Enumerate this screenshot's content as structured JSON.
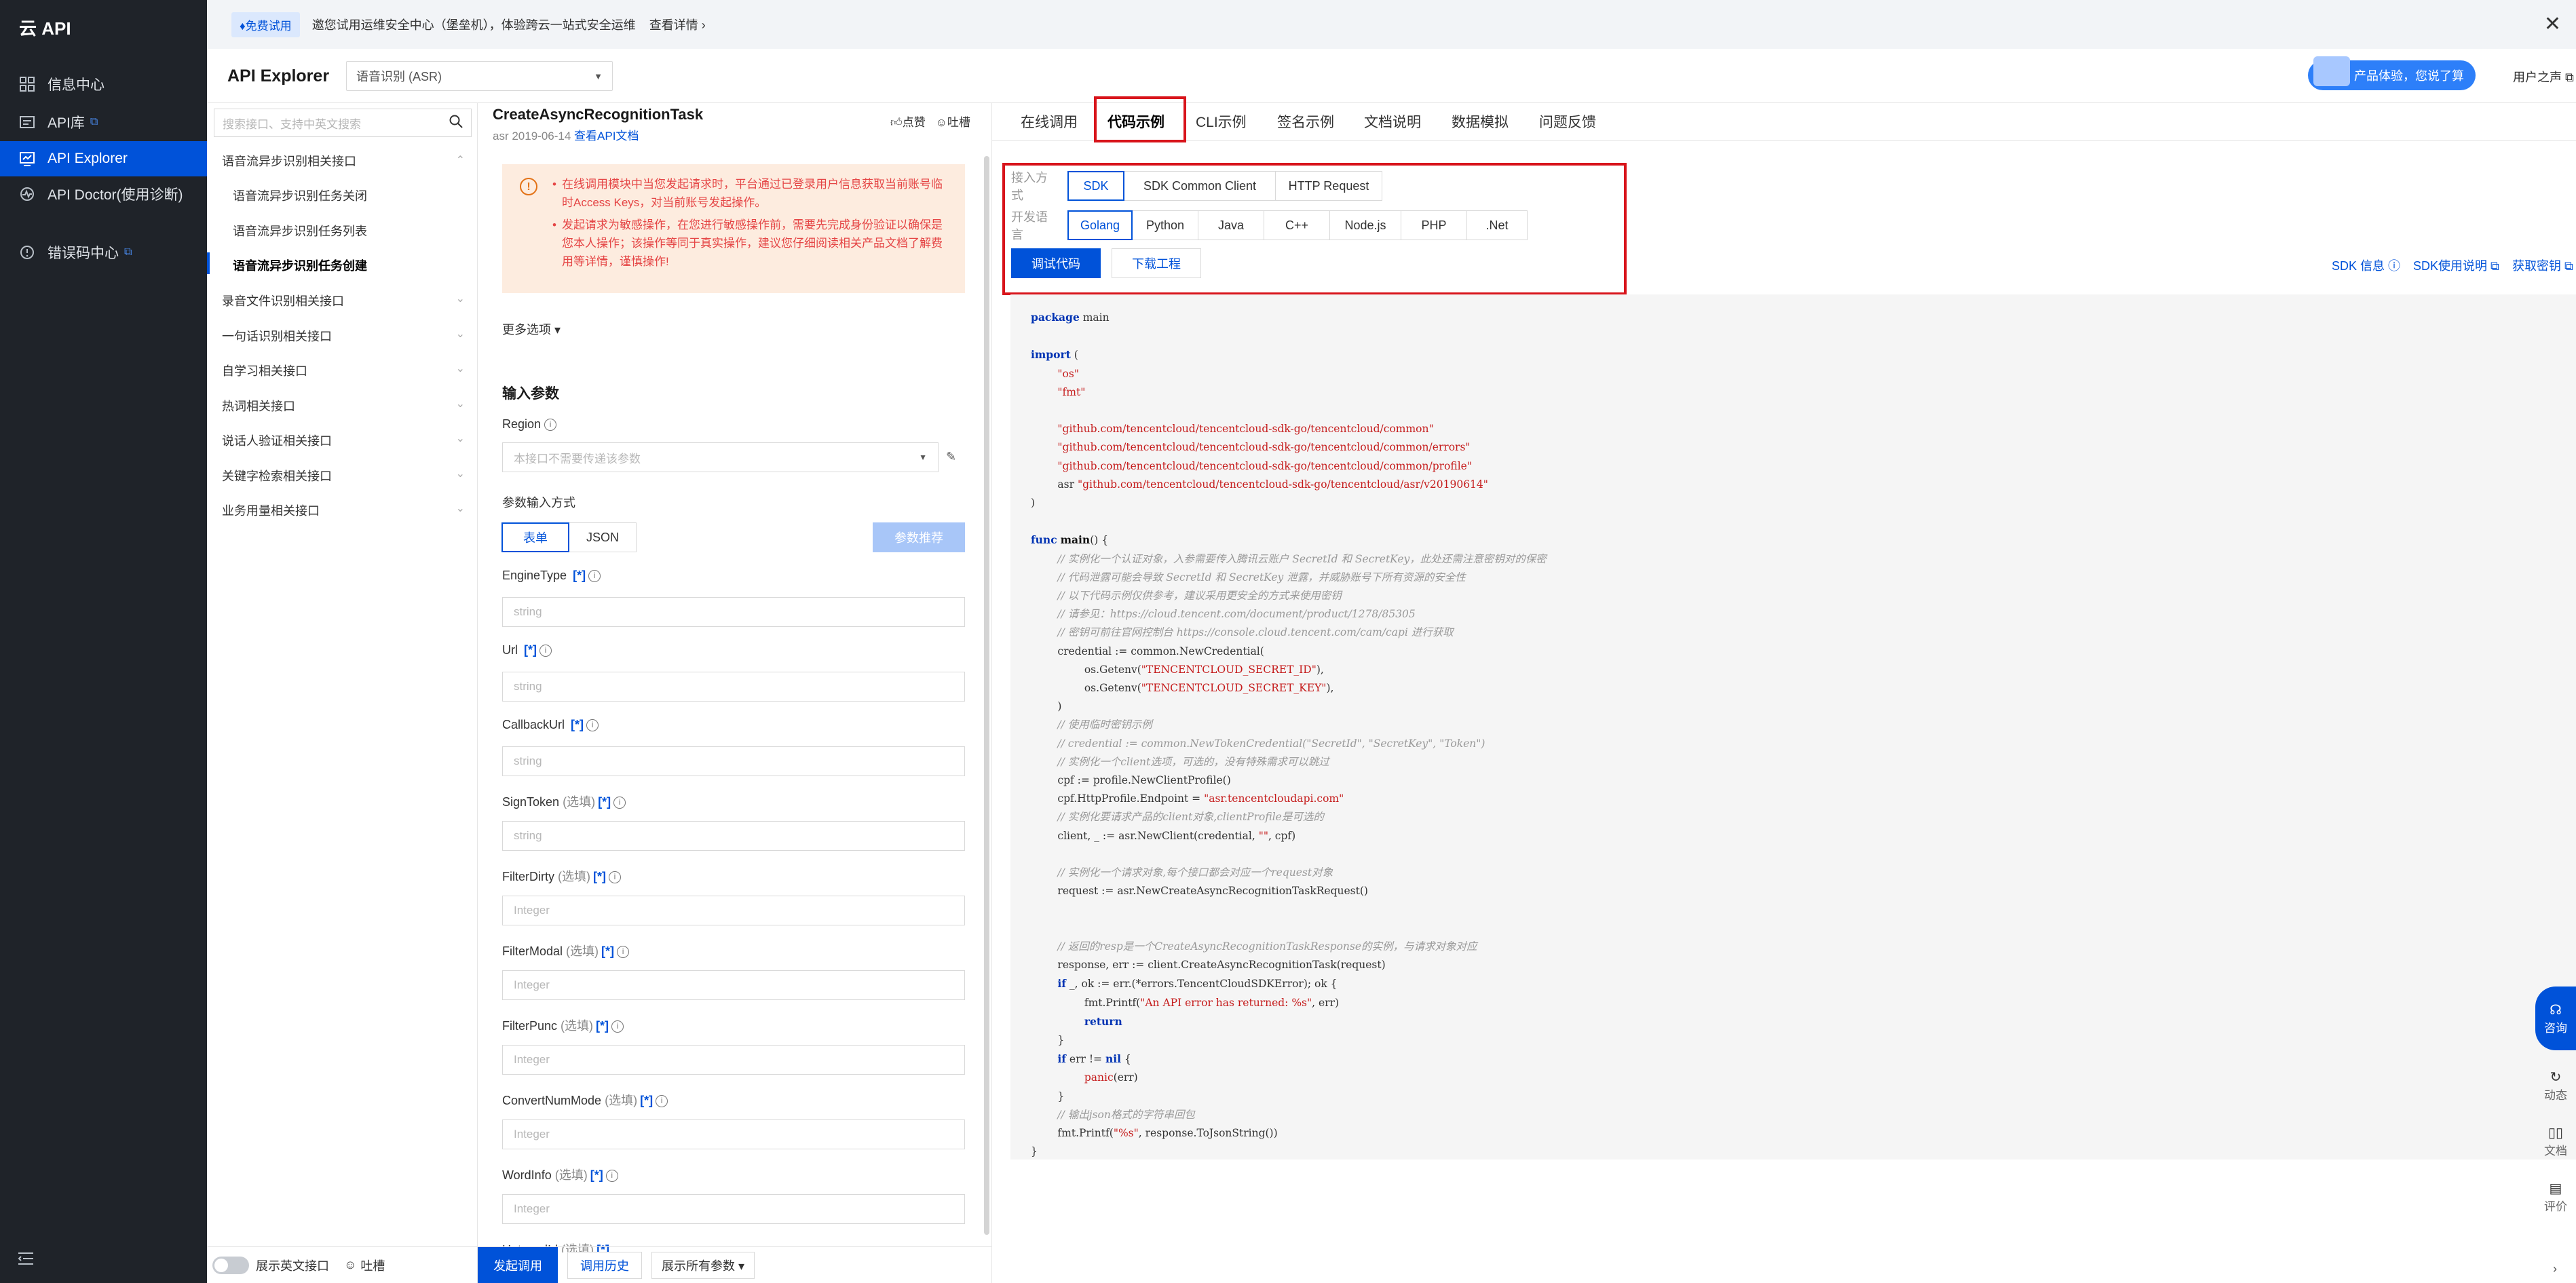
{
  "nav": {
    "brand": "云 API",
    "items": [
      {
        "label": "信息中心",
        "icon": "dashboard-icon"
      },
      {
        "label": "API库",
        "icon": "library-icon",
        "external": true
      },
      {
        "label": "API Explorer",
        "icon": "explorer-icon",
        "active": true
      },
      {
        "label": "API Doctor(使用诊断)",
        "icon": "doctor-icon"
      },
      {
        "label": "错误码中心",
        "icon": "error-code-icon",
        "external": true
      }
    ],
    "collapse_icon": "menu-collapse-icon"
  },
  "banner": {
    "badge": "♦免费试用",
    "text": "邀您试用运维安全中心（堡垒机），体验跨云一站式安全运维",
    "more": "查看详情 ›",
    "close": "✕"
  },
  "header": {
    "title": "API Explorer",
    "product_select": "语音识别 (ASR)",
    "promo": "产品体验，您说了算",
    "user_link": "用户之声"
  },
  "interface_list": {
    "search_placeholder": "搜索接口、支持中英文搜索",
    "groups": [
      {
        "label": "语音流异步识别相关接口",
        "expanded": true,
        "children": [
          "语音流异步识别任务关闭",
          "语音流异步识别任务列表",
          "语音流异步识别任务创建"
        ],
        "active_child": 2
      },
      {
        "label": "录音文件识别相关接口"
      },
      {
        "label": "一句话识别相关接口"
      },
      {
        "label": "自学习相关接口"
      },
      {
        "label": "热词相关接口"
      },
      {
        "label": "说话人验证相关接口"
      },
      {
        "label": "关键字检索相关接口"
      },
      {
        "label": "业务用量相关接口"
      }
    ],
    "footer_toggle": "展示英文接口",
    "footer_feedback": "吐槽"
  },
  "form": {
    "title": "CreateAsyncRecognitionTask",
    "subtitle_prefix": "asr 2019-06-14 ",
    "doc_link": "查看API文档",
    "like": "点赞",
    "feedback": "吐槽",
    "warnings": [
      "在线调用模块中当您发起请求时，平台通过已登录用户信息获取当前账号临时Access Keys，对当前账号发起操作。",
      "发起请求为敏感操作，在您进行敏感操作前，需要先完成身份验证以确保是您本人操作；该操作等同于真实操作，建议您仔细阅读相关产品文档了解费用等详情，谨慎操作!"
    ],
    "more_options": "更多选项 ▾",
    "section_title": "输入参数",
    "region_label": "Region",
    "region_placeholder": "本接口不需要传递该参数",
    "input_mode_label": "参数输入方式",
    "mode_form": "表单",
    "mode_json": "JSON",
    "recommend": "参数推荐",
    "params": [
      {
        "name": "EngineType",
        "optional": "",
        "required": "[*]",
        "placeholder": "string"
      },
      {
        "name": "Url",
        "optional": "",
        "required": "[*]",
        "placeholder": "string"
      },
      {
        "name": "CallbackUrl",
        "optional": "",
        "required": "[*]",
        "placeholder": "string"
      },
      {
        "name": "SignToken",
        "optional": "(选填)",
        "required": "[*]",
        "placeholder": "string"
      },
      {
        "name": "FilterDirty",
        "optional": "(选填)",
        "required": "[*]",
        "placeholder": "Integer"
      },
      {
        "name": "FilterModal",
        "optional": "(选填)",
        "required": "[*]",
        "placeholder": "Integer"
      },
      {
        "name": "FilterPunc",
        "optional": "(选填)",
        "required": "[*]",
        "placeholder": "Integer"
      },
      {
        "name": "ConvertNumMode",
        "optional": "(选填)",
        "required": "[*]",
        "placeholder": "Integer"
      },
      {
        "name": "WordInfo",
        "optional": "(选填)",
        "required": "[*]",
        "placeholder": "Integer"
      },
      {
        "name": "HotwordId",
        "optional": "(选填)",
        "required": "[*]",
        "placeholder": ""
      }
    ],
    "footer": {
      "send": "发起调用",
      "history": "调用历史",
      "show_all": "展示所有参数 ▾"
    }
  },
  "right": {
    "tabs": [
      "在线调用",
      "代码示例",
      "CLI示例",
      "签名示例",
      "文档说明",
      "数据模拟",
      "问题反馈"
    ],
    "active_tab": 1,
    "access_label": "接入方式",
    "access_options": [
      "SDK",
      "SDK Common Client",
      "HTTP Request"
    ],
    "lang_label": "开发语言",
    "lang_options": [
      "Golang",
      "Python",
      "Java",
      "C++",
      "Node.js",
      "PHP",
      ".Net"
    ],
    "debug_button": "调试代码",
    "download_button": "下载工程",
    "links": [
      "SDK 信息",
      "SDK使用说明",
      "获取密钥"
    ],
    "float": [
      "咨询",
      "动态",
      "文档",
      "评价"
    ]
  }
}
